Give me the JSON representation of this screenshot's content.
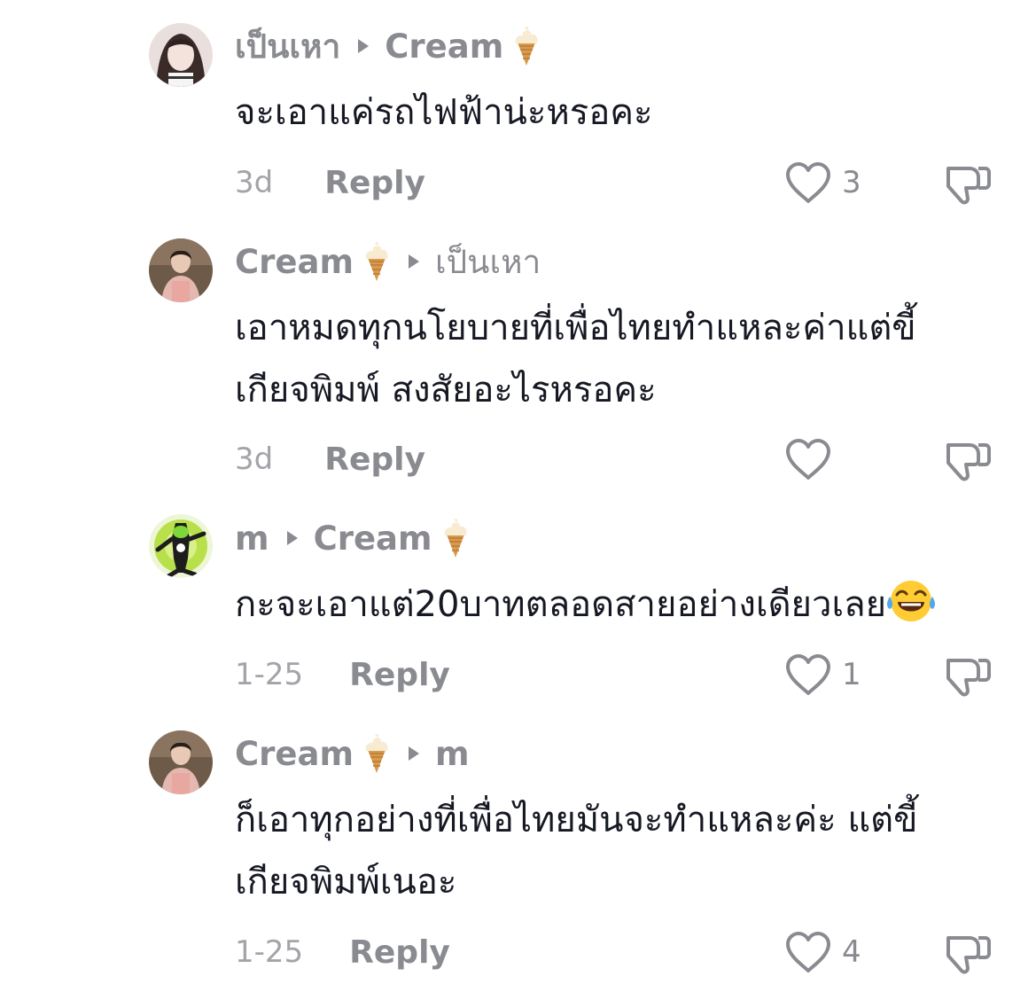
{
  "comments": [
    {
      "author": "เป็นเหา",
      "reply_to": "Cream",
      "reply_to_emoji": "ice-cream-cone",
      "text": "จะเอาแค่รถไฟฟ้าน่ะหรอคะ",
      "time": "3d",
      "reply_label": "Reply",
      "likes": "3"
    },
    {
      "author": "Cream",
      "author_emoji": "ice-cream-cone",
      "reply_to": "เป็นเหา",
      "text": "เอาหมดทุกนโยบายที่เพื่อไทยทำแหละค่าแต่ขี้\nเกียจพิมพ์ สงสัยอะไรหรอคะ",
      "time": "3d",
      "reply_label": "Reply",
      "likes": ""
    },
    {
      "author": "m",
      "reply_to": "Cream",
      "reply_to_emoji": "ice-cream-cone",
      "text": "กะจะเอาแต่20บาทตลอดสายอย่างเดียวเลย",
      "text_emoji": "face-with-tears-of-joy",
      "time": "1-25",
      "reply_label": "Reply",
      "likes": "1"
    },
    {
      "author": "Cream",
      "author_emoji": "ice-cream-cone",
      "reply_to": "m",
      "text": "ก็เอาทุกอย่างที่เพื่อไทยมันจะทำแหละค่ะ แต่ขี้\nเกียจพิมพ์เนอะ",
      "time": "1-25",
      "reply_label": "Reply",
      "likes": "4"
    }
  ],
  "icons": {
    "like": "heart-outline-icon",
    "dislike": "thumbs-down-outline-icon",
    "reply_arrow": "triangle-right-icon"
  },
  "colors": {
    "muted_text": "#8a8b91",
    "time_text": "#a3a4a9",
    "body_text": "#161823"
  }
}
